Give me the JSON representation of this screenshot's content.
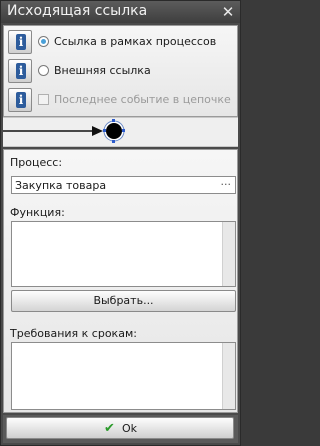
{
  "window": {
    "title": "Исходящая ссылка",
    "close_glyph": "✕"
  },
  "options": [
    {
      "label": "Ссылка в рамках процессов",
      "control": "radio",
      "checked": true,
      "enabled": true
    },
    {
      "label": "Внешняя ссылка",
      "control": "radio",
      "checked": false,
      "enabled": true
    },
    {
      "label": "Последнее событие в цепочке",
      "control": "checkbox",
      "checked": false,
      "enabled": false
    }
  ],
  "info_glyph": "i",
  "process": {
    "label": "Процесс:",
    "value": "Закупка товара",
    "browse_glyph": "···"
  },
  "function": {
    "label": "Функция:",
    "value": ""
  },
  "select_button": {
    "label": "Выбрать..."
  },
  "requirements": {
    "label": "Требования к срокам:",
    "value": ""
  },
  "ok_button": {
    "label": "Ok",
    "check_glyph": "✔"
  },
  "colors": {
    "accent": "#4aa0d8",
    "info_icon": "#2d5c9c",
    "ok_check": "#2a9a2a"
  }
}
